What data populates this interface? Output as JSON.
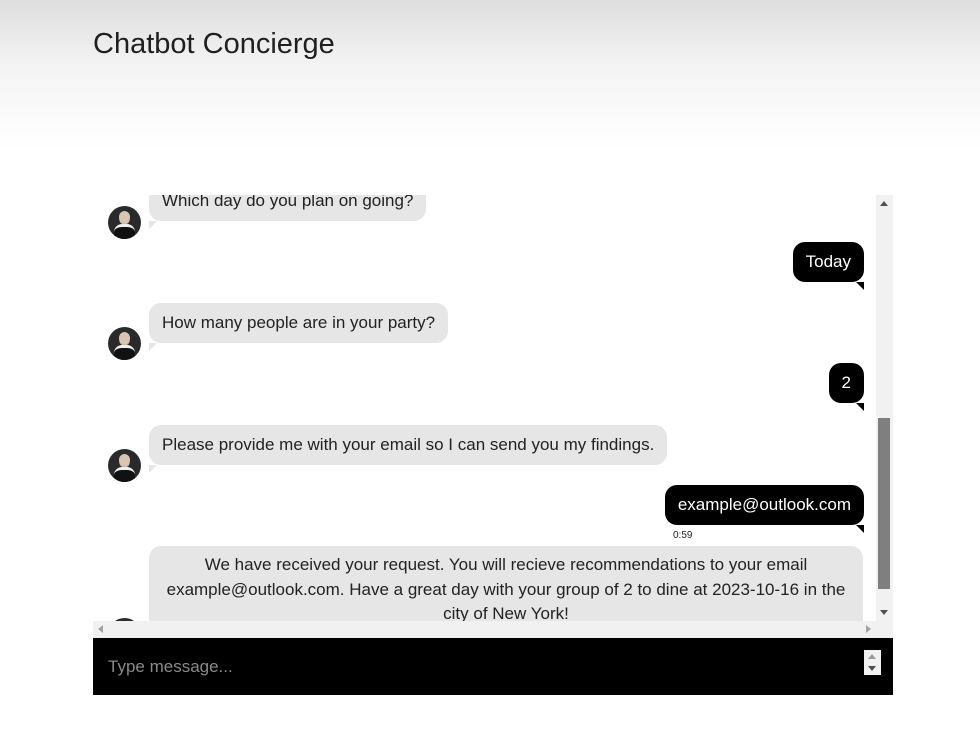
{
  "header": {
    "title": "Chatbot Concierge"
  },
  "messages": [
    {
      "sender": "bot",
      "text": "Which day do you plan on going?"
    },
    {
      "sender": "user",
      "text": "Today"
    },
    {
      "sender": "bot",
      "text": "How many people are in your party?"
    },
    {
      "sender": "user",
      "text": "2"
    },
    {
      "sender": "bot",
      "text": "Please provide me with your email so I can send you my findings."
    },
    {
      "sender": "user",
      "text": "example@outlook.com",
      "time": "0:59"
    },
    {
      "sender": "bot",
      "text": "We have received your request. You will recieve recommendations to your email example@outlook.com. Have a great day with your group of 2 to dine at 2023-10-16 in the city of New York!"
    }
  ],
  "composer": {
    "placeholder": "Type message..."
  },
  "colors": {
    "bot_bubble": "#e6e6e6",
    "user_bubble": "#000000",
    "input_bar": "#000000"
  }
}
